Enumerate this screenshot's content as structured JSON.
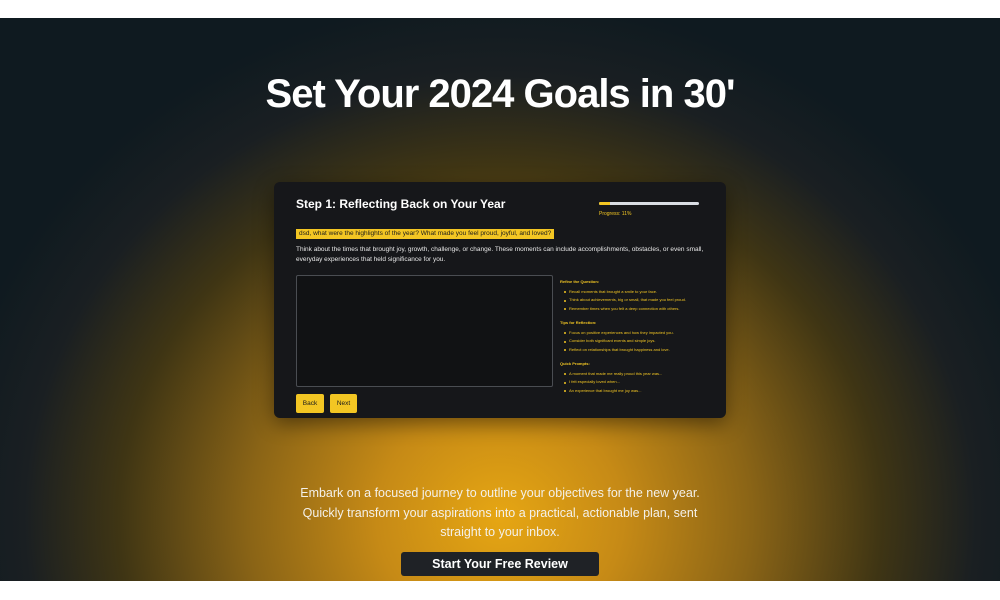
{
  "hero": {
    "title": "Set Your 2024 Goals in 30'",
    "tagline": "Embark on a focused journey to outline your objectives for the new year. Quickly transform your aspirations into a practical, actionable plan, sent straight to your inbox.",
    "cta_label": "Start Your Free Review"
  },
  "card": {
    "step_title": "Step 1: Reflecting Back on Your Year",
    "progress_label": "Progress: 11%",
    "progress_fraction": 0.11,
    "question": "dsd, what were the highlights of the year? What made you feel proud, joyful, and loved?",
    "description": "Think about the times that brought joy, growth, challenge, or change. These moments can include accomplishments, obstacles, or even small, everyday experiences that held significance for you.",
    "answer_value": "",
    "back_label": "Back",
    "next_label": "Next",
    "aside": {
      "refine_title": "Refine the Question:",
      "refine_items": [
        "Recall moments that brought a smile to your face.",
        "Think about achievements, big or small, that made you feel proud.",
        "Remember times when you felt a deep connection with others."
      ],
      "tips_title": "Tips for Reflection:",
      "tips_items": [
        "Focus on positive experiences and how they impacted you.",
        "Consider both significant events and simple joys.",
        "Reflect on relationships that brought happiness and love."
      ],
      "prompts_title": "Quick Prompts:",
      "prompts_items": [
        "A moment that made me really proud this year was...",
        "I felt especially loved when...",
        "An experience that brought me joy was..."
      ]
    }
  },
  "colors": {
    "accent": "#f3c623",
    "card_bg": "#16171a",
    "page_dark": "#0f1a20",
    "glow": "#e6a613",
    "cta_bg": "#1f2226"
  }
}
